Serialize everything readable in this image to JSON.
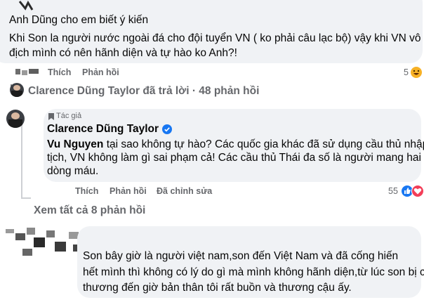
{
  "top_comment": {
    "line1": "Anh Dũng cho em biết ý kiến",
    "line2": "Khi Son la người nước ngoài đá cho đội tuyển VN ( ko phải câu lạc bộ) vậy khi VN vô",
    "line3": "địch mình có nên hãnh diện và tự hào ko Anh?!",
    "like_label": "Thích",
    "reply_label": "Phản hồi",
    "reaction_count": "5"
  },
  "replied_summary": {
    "text": "Clarence Dũng Taylor đã trả lời · 48 phản hồi"
  },
  "reply_comment": {
    "badge": "Tác giả",
    "author": "Clarence Dũng Taylor",
    "mention": "Vu Nguyen",
    "line1_rest": " tại sao không tự hào? Các quốc gia khác đã sử dụng cầu thủ nhập",
    "line2": "tịch, VN không làm gì sai phạm cả! Các cầu thủ Thái đa số là người mang hai",
    "line3": "dòng máu.",
    "like_label": "Thích",
    "reply_label": "Phản hồi",
    "edited_label": "Đã chỉnh sửa",
    "reaction_count": "55"
  },
  "view_all": {
    "text": "Xem tất cả 8 phản hồi"
  },
  "bottom_comment": {
    "line1": "Son bây giờ là người việt nam,son đến Việt Nam và đã cống hiến",
    "line2": "hết mình thì không có lý do gì mà mình không hãnh diện,từ lúc son bị chấn",
    "line3": "thương đến giờ bản thân tôi rất buồn và thương cậu ấy."
  },
  "colors": {
    "bubble": "#f0f2f5",
    "meta_text": "#65676b",
    "verified": "#1877f2"
  },
  "icons": [
    "haha-reaction-icon",
    "like-reaction-icon",
    "love-reaction-icon",
    "verified-badge-icon",
    "author-badge-icon",
    "reply-arrow-icon"
  ]
}
